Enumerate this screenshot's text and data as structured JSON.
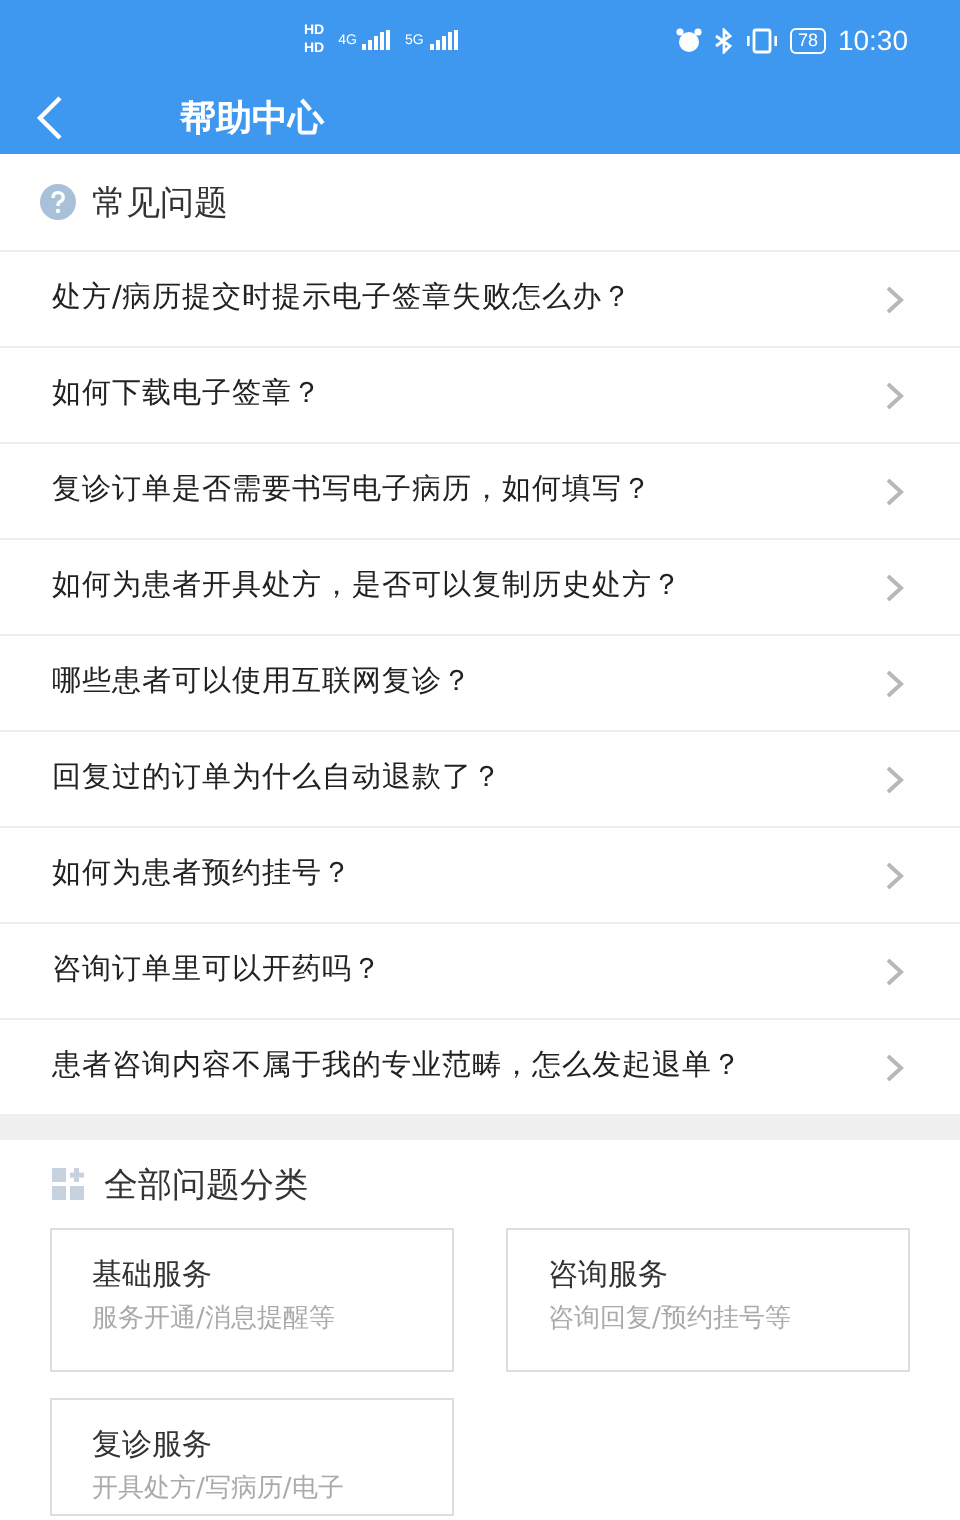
{
  "status_bar": {
    "sim_labels": [
      "HD",
      "HD"
    ],
    "network_labels": [
      "4G",
      "5G"
    ],
    "battery": "78",
    "time": "10:30"
  },
  "header": {
    "title": "帮助中心"
  },
  "faq": {
    "title": "常见问题",
    "items": [
      {
        "text": "处方/病历提交时提示电子签章失败怎么办？"
      },
      {
        "text": "如何下载电子签章？"
      },
      {
        "text": "复诊订单是否需要书写电子病历，如何填写？"
      },
      {
        "text": "如何为患者开具处方，是否可以复制历史处方？"
      },
      {
        "text": "哪些患者可以使用互联网复诊？"
      },
      {
        "text": "回复过的订单为什么自动退款了？"
      },
      {
        "text": "如何为患者预约挂号？"
      },
      {
        "text": "咨询订单里可以开药吗？"
      },
      {
        "text": "患者咨询内容不属于我的专业范畴，怎么发起退单？"
      }
    ]
  },
  "categories": {
    "title": "全部问题分类",
    "items": [
      {
        "name": "基础服务",
        "desc": "服务开通/消息提醒等"
      },
      {
        "name": "咨询服务",
        "desc": "咨询回复/预约挂号等"
      },
      {
        "name": "复诊服务",
        "desc": "开具处方/写病历/电子"
      }
    ]
  }
}
